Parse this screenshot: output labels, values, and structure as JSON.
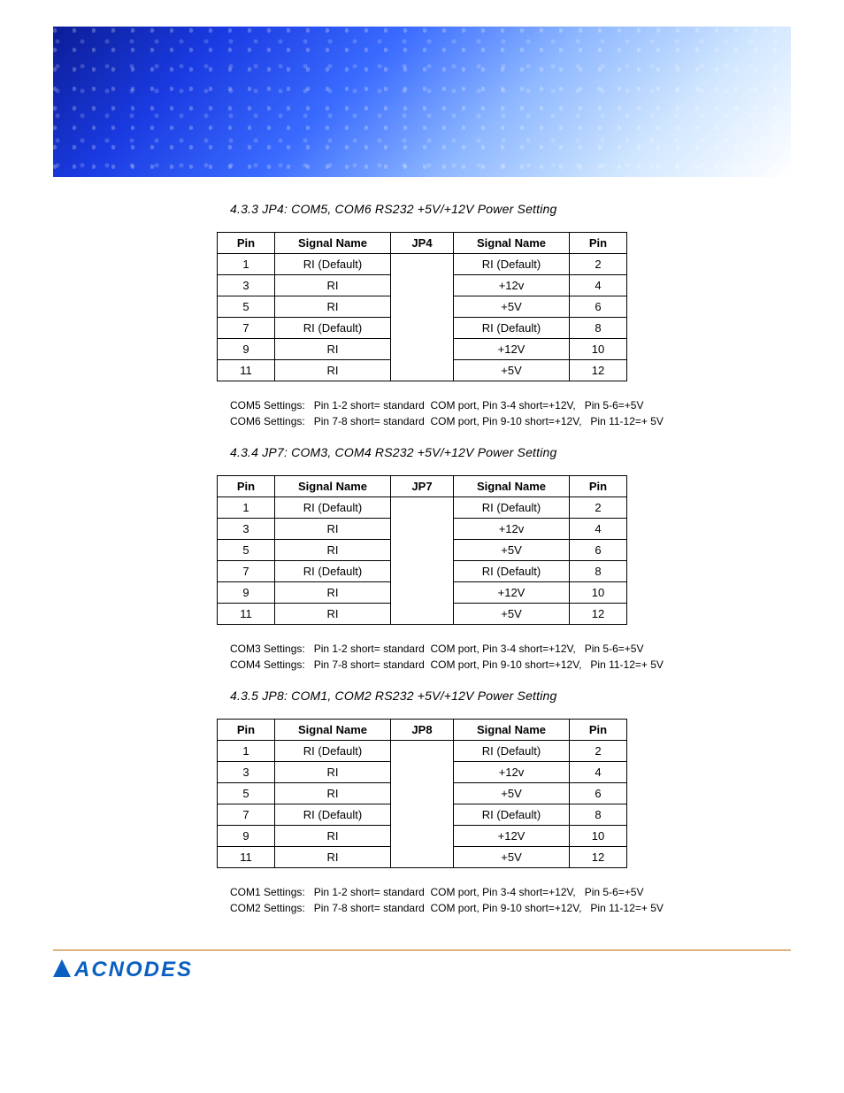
{
  "branding": {
    "name": "ACNODES"
  },
  "sections": [
    {
      "id": "s433",
      "title": "4.3.3  JP4: COM5,  COM6 RS232 +5V/+12V Power Setting",
      "jumper": "JP4",
      "headers": {
        "pinL": "Pin",
        "sigL": "Signal Name",
        "jp": "JP4",
        "sigR": "Signal Name",
        "pinR": "Pin"
      },
      "rows": [
        {
          "pl": "1",
          "sl": "RI (Default)",
          "sr": "RI (Default)",
          "pr": "2"
        },
        {
          "pl": "3",
          "sl": "RI",
          "sr": "+12v",
          "pr": "4"
        },
        {
          "pl": "5",
          "sl": "RI",
          "sr": "+5V",
          "pr": "6"
        },
        {
          "pl": "7",
          "sl": "RI (Default)",
          "sr": "RI (Default)",
          "pr": "8"
        },
        {
          "pl": "9",
          "sl": "RI",
          "sr": "+12V",
          "pr": "10"
        },
        {
          "pl": "11",
          "sl": "RI",
          "sr": "+5V",
          "pr": "12"
        }
      ],
      "notes": "COM5 Settings:   Pin 1-2 short= standard  COM port, Pin 3-4 short=+12V,   Pin 5-6=+5V\nCOM6 Settings:   Pin 7-8 short= standard  COM port, Pin 9-10 short=+12V,   Pin 11-12=+ 5V"
    },
    {
      "id": "s434",
      "title": "4.3.4  JP7: COM3,  COM4 RS232 +5V/+12V Power Setting",
      "jumper": "JP7",
      "headers": {
        "pinL": "Pin",
        "sigL": "Signal Name",
        "jp": "JP7",
        "sigR": "Signal Name",
        "pinR": "Pin"
      },
      "rows": [
        {
          "pl": "1",
          "sl": "RI (Default)",
          "sr": "RI (Default)",
          "pr": "2"
        },
        {
          "pl": "3",
          "sl": "RI",
          "sr": "+12v",
          "pr": "4"
        },
        {
          "pl": "5",
          "sl": "RI",
          "sr": "+5V",
          "pr": "6"
        },
        {
          "pl": "7",
          "sl": "RI (Default)",
          "sr": "RI (Default)",
          "pr": "8"
        },
        {
          "pl": "9",
          "sl": "RI",
          "sr": "+12V",
          "pr": "10"
        },
        {
          "pl": "11",
          "sl": "RI",
          "sr": "+5V",
          "pr": "12"
        }
      ],
      "notes": "COM3 Settings:   Pin 1-2 short= standard  COM port, Pin 3-4 short=+12V,   Pin 5-6=+5V\nCOM4 Settings:   Pin 7-8 short= standard  COM port, Pin 9-10 short=+12V,   Pin 11-12=+ 5V"
    },
    {
      "id": "s435",
      "title": "4.3.5  JP8: COM1,  COM2 RS232 +5V/+12V Power Setting",
      "jumper": "JP8",
      "headers": {
        "pinL": "Pin",
        "sigL": "Signal Name",
        "jp": "JP8",
        "sigR": "Signal Name",
        "pinR": "Pin"
      },
      "rows": [
        {
          "pl": "1",
          "sl": "RI (Default)",
          "sr": "RI (Default)",
          "pr": "2"
        },
        {
          "pl": "3",
          "sl": "RI",
          "sr": "+12v",
          "pr": "4"
        },
        {
          "pl": "5",
          "sl": "RI",
          "sr": "+5V",
          "pr": "6"
        },
        {
          "pl": "7",
          "sl": "RI (Default)",
          "sr": "RI (Default)",
          "pr": "8"
        },
        {
          "pl": "9",
          "sl": "RI",
          "sr": "+12V",
          "pr": "10"
        },
        {
          "pl": "11",
          "sl": "RI",
          "sr": "+5V",
          "pr": "12"
        }
      ],
      "notes": "COM1 Settings:   Pin 1-2 short= standard  COM port, Pin 3-4 short=+12V,   Pin 5-6=+5V\nCOM2 Settings:   Pin 7-8 short= standard  COM port, Pin 9-10 short=+12V,   Pin 11-12=+ 5V"
    }
  ]
}
